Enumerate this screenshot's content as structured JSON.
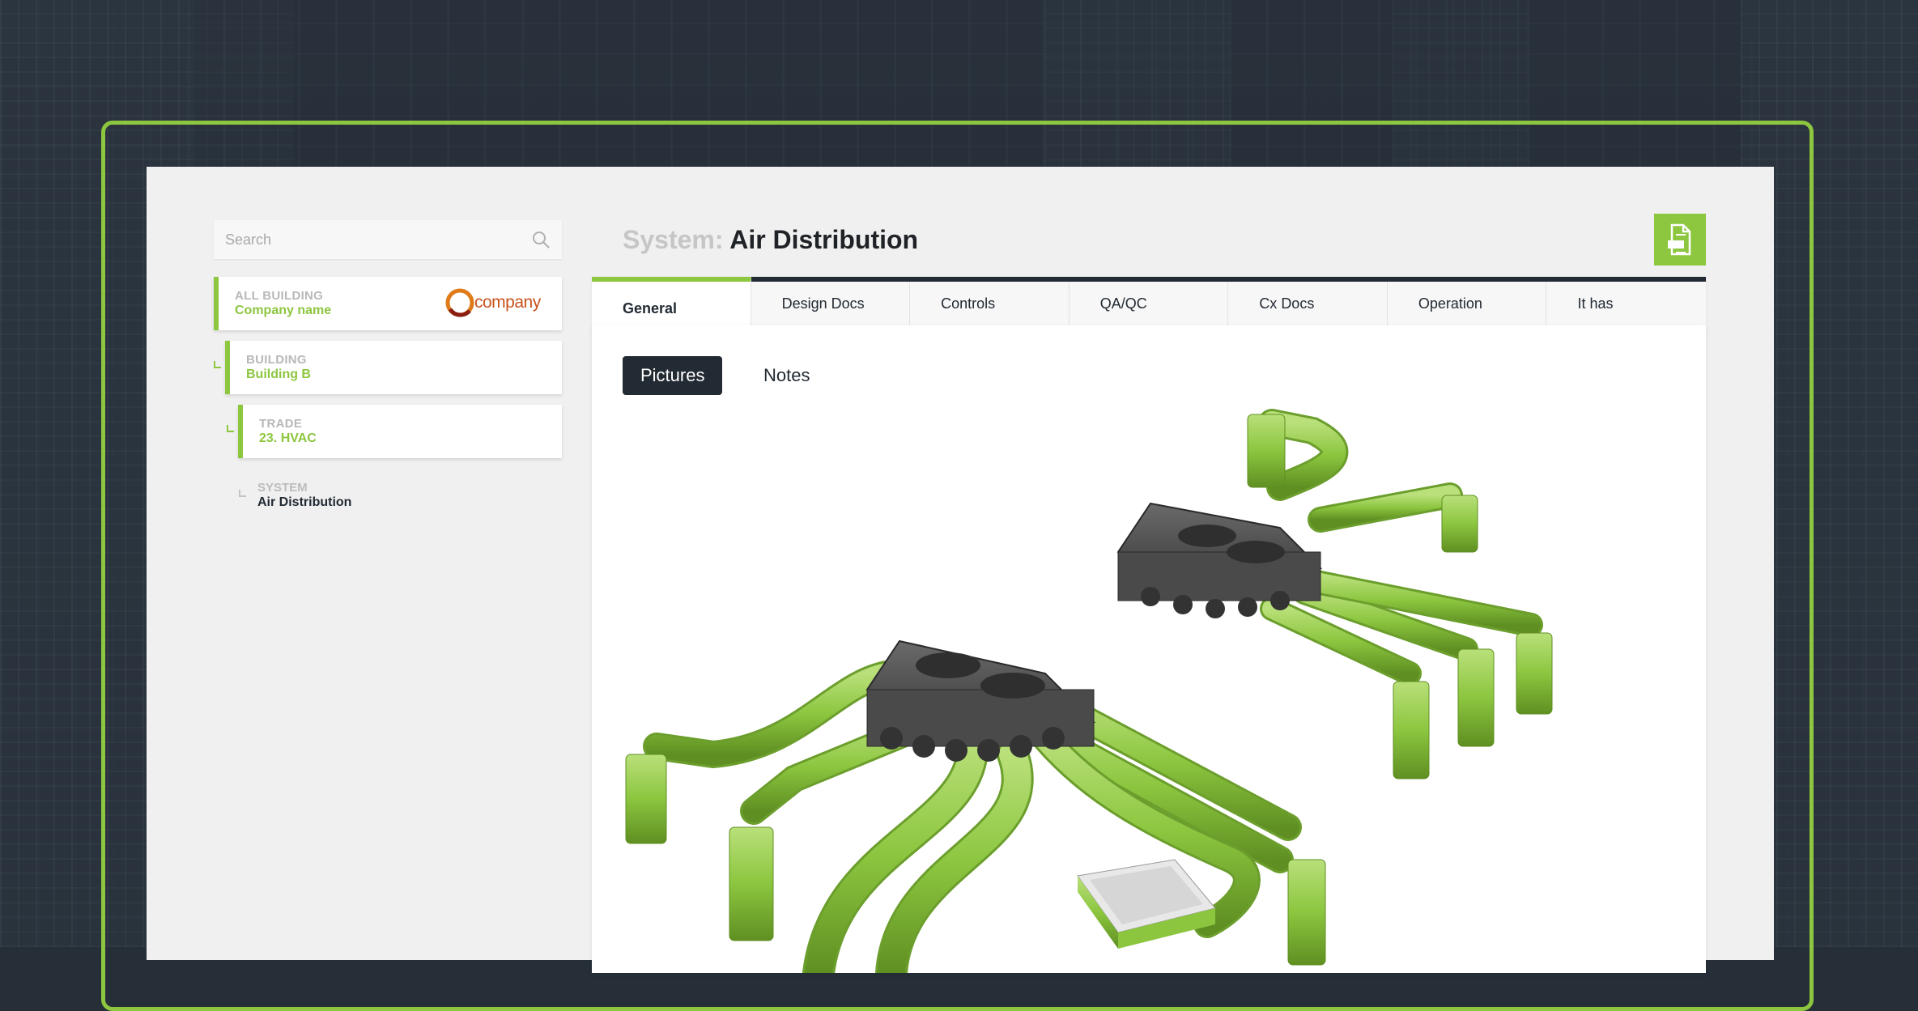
{
  "sidebar": {
    "search_placeholder": "Search",
    "nodes": [
      {
        "label": "ALL BUILDING",
        "value": "Company name"
      },
      {
        "label": "BUILDING",
        "value": "Building B"
      },
      {
        "label": "TRADE",
        "value": "23. HVAC"
      },
      {
        "label": "SYSTEM",
        "value": "Air Distribution"
      }
    ],
    "logo_text": "company"
  },
  "header": {
    "title_prefix": "System:",
    "title": "Air Distribution"
  },
  "tabs": [
    "General",
    "Design Docs",
    "Controls",
    "QA/QC",
    "Cx Docs",
    "Operation",
    "It has"
  ],
  "active_tab": "General",
  "subtabs": [
    "Pictures",
    "Notes"
  ],
  "active_subtab": "Pictures",
  "colors": {
    "accent": "#8dc63f",
    "dark": "#222a33",
    "panel": "#f0f0f0"
  },
  "icons": {
    "search": "search-icon",
    "pdf": "pdf-export-icon"
  }
}
